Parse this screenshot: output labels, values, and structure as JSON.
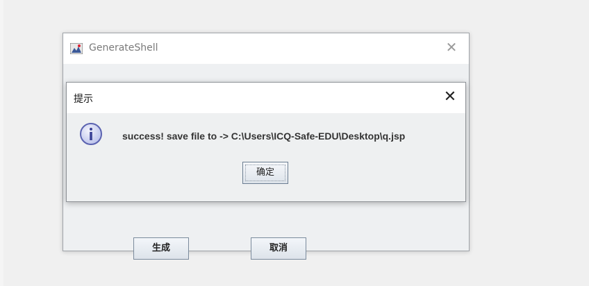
{
  "parent_window": {
    "title": "GenerateShell",
    "close_glyph": "✕",
    "icon": "java-app-icon",
    "buttons": {
      "generate_label": "生成",
      "cancel_label": "取消"
    }
  },
  "dialog": {
    "title": "提示",
    "close_glyph": "✕",
    "icon": "info-icon",
    "message": "success! save file to -> C:\\Users\\ICQ-Safe-EDU\\Desktop\\q.jsp",
    "ok_label": "确定"
  },
  "colors": {
    "info_icon_fill": "#c9cff0",
    "info_icon_stroke": "#5a62b0",
    "button_border": "#7a8a9c"
  }
}
